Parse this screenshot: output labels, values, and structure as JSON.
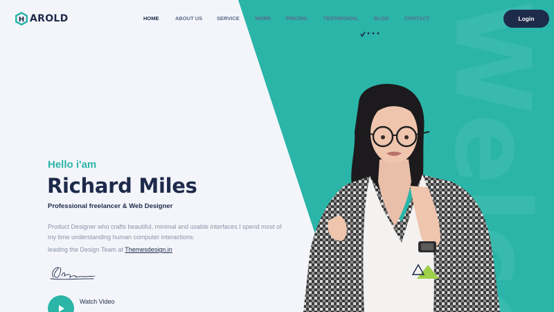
{
  "brand": {
    "name": "HAROLD",
    "logo_letter": "H",
    "logo_rest": "AROLD"
  },
  "nav": {
    "items": [
      {
        "label": "HOME",
        "active": true
      },
      {
        "label": "ABOUT US",
        "active": false
      },
      {
        "label": "SERVICE",
        "active": false
      },
      {
        "label": "WORK",
        "active": false
      },
      {
        "label": "PRICING",
        "active": false
      },
      {
        "label": "TESTIMONIAL",
        "active": false
      },
      {
        "label": "BLOG",
        "active": false
      },
      {
        "label": "CONTACT",
        "active": false
      }
    ],
    "login_label": "Login"
  },
  "hero": {
    "greeting": "Hello i'am",
    "name": "Richard Miles",
    "role": "Professional freelancer & Web Designer",
    "description": "Product Designer who crafts beautiful, minimal and usable interfaces.I spend most of my time understanding human computer interactions.",
    "lead_prefix": "leading the Design Team at ",
    "lead_link": "Themesdesign.in",
    "watch_label": "Watch Video"
  },
  "decor": {
    "watermark": "Welcome"
  },
  "colors": {
    "teal": "#2ab5a8",
    "navy": "#1e2a4a",
    "muted": "#8a93a8",
    "background": "#f4f5fa"
  },
  "icons": {
    "logo": "hexagon-logo-icon",
    "play": "play-icon",
    "loader": "loader-dots-icon",
    "signature": "signature-image"
  }
}
